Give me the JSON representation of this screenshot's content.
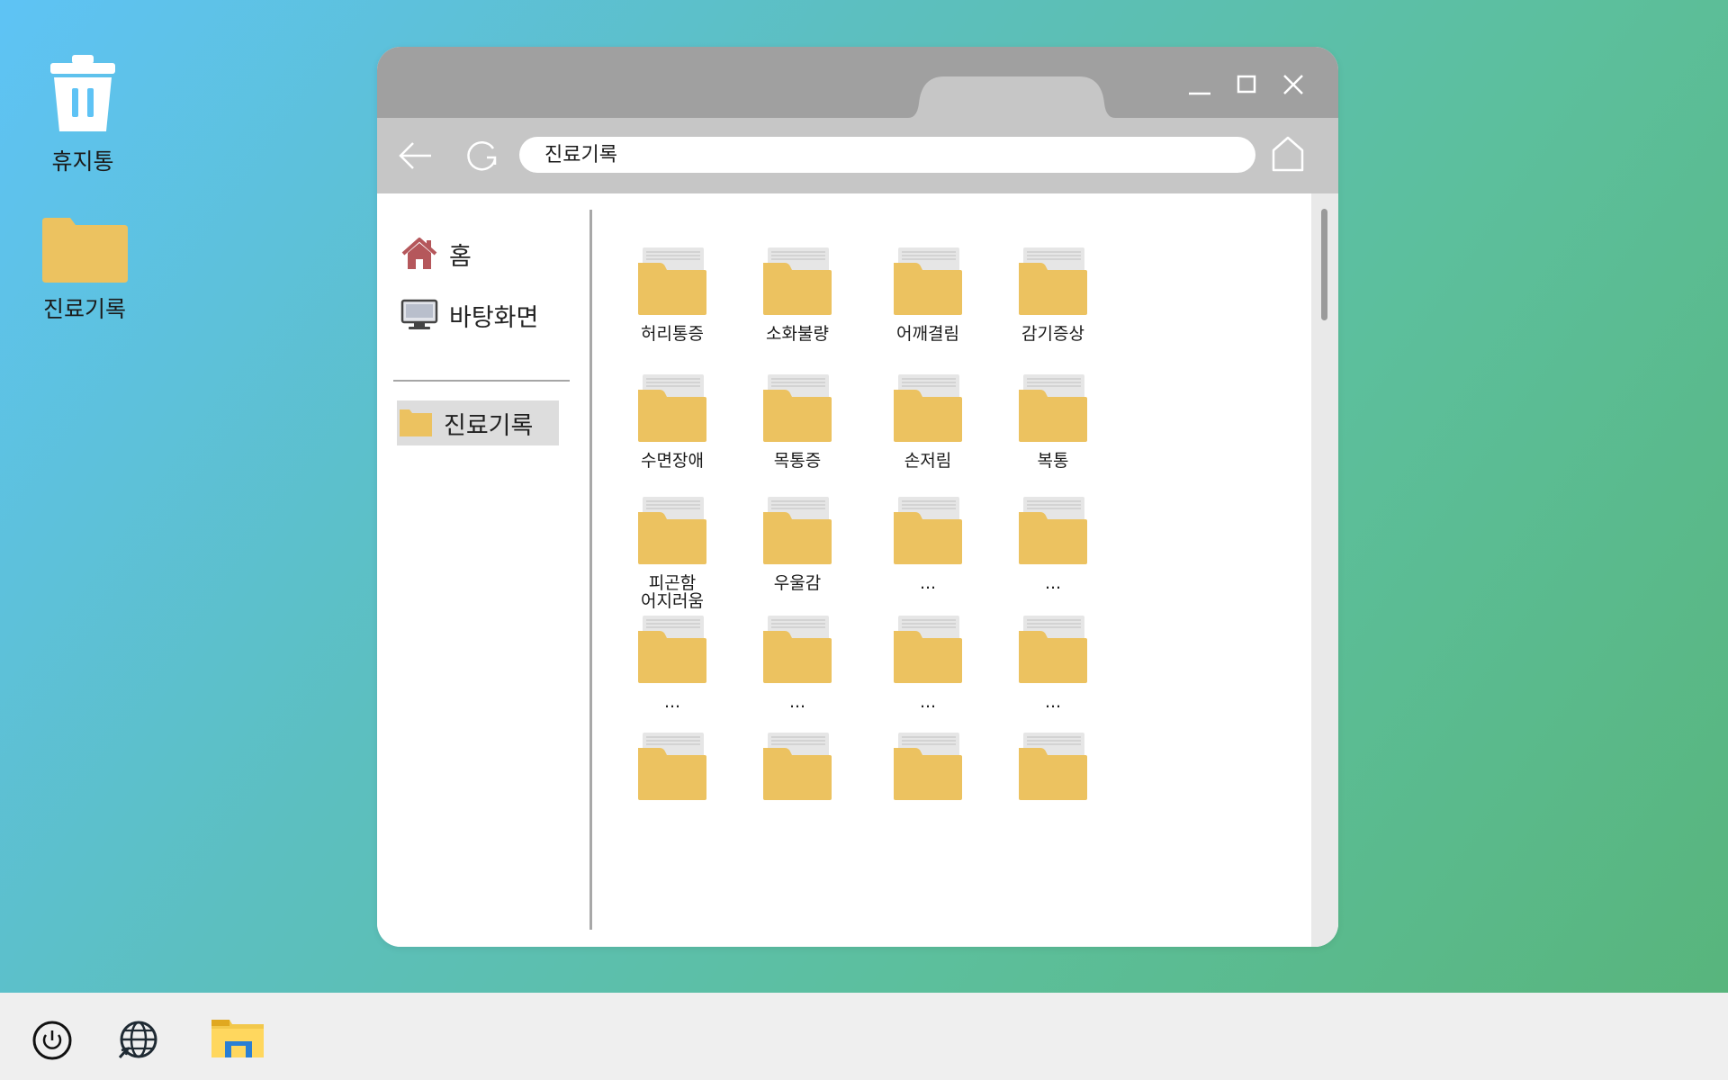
{
  "desktop": {
    "icons": [
      {
        "label": "휴지통",
        "icon": "trash-icon"
      },
      {
        "label": "진료기록",
        "icon": "folder-icon"
      }
    ]
  },
  "window": {
    "address": "진료기록",
    "sidebar": {
      "home_label": "홈",
      "desktop_label": "바탕화면",
      "records_label": "진료기록"
    },
    "folders": [
      "허리통증",
      "소화불량",
      "어깨결림",
      "감기증상",
      "수면장애",
      "목통증",
      "손저림",
      "복통",
      "피곤함\n어지러움",
      "우울감",
      "...",
      "...",
      "...",
      "...",
      "...",
      "...",
      "",
      "",
      "",
      ""
    ]
  },
  "colors": {
    "folder": "#ecc260",
    "folder_paper": "#e6e6e6",
    "titlebar": "#a0a0a0",
    "toolbar": "#c6c6c6",
    "taskbar": "#efefef",
    "home_icon": "#b5575b"
  },
  "taskbar": {
    "icons": [
      "power-icon",
      "globe-icon",
      "file-explorer-icon"
    ]
  }
}
